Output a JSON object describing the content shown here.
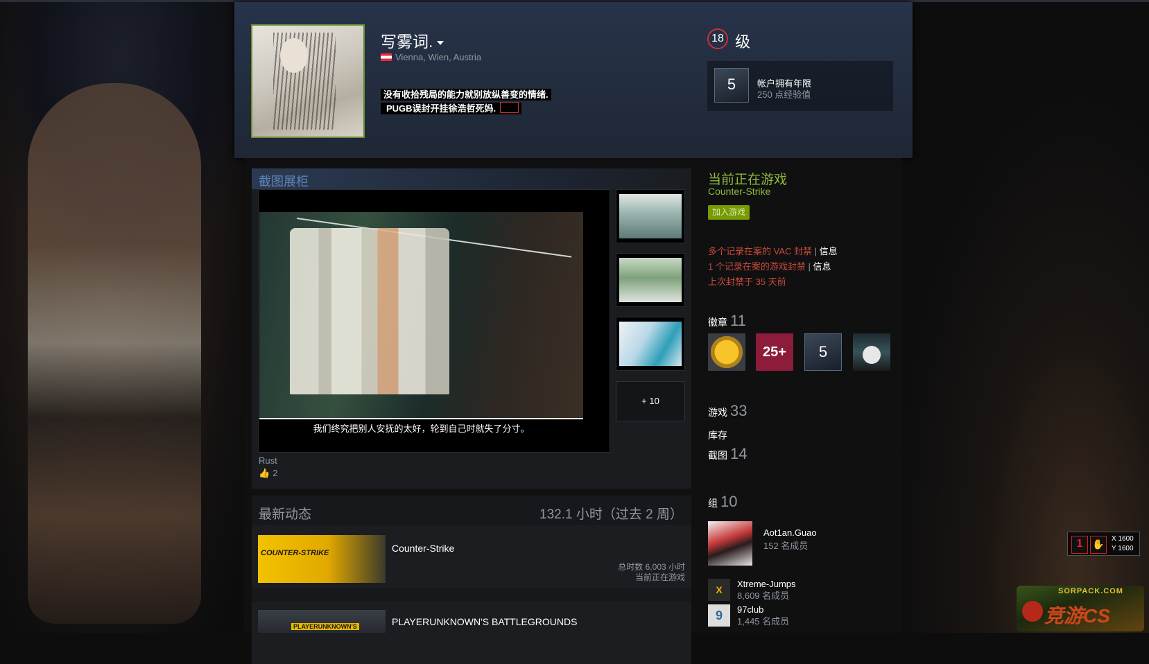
{
  "profile": {
    "persona_name": "写雾词.",
    "location": "Vienna, Wien, Austria",
    "summary_line1": "没有收拾残局的能力就别放纵善变的情绪.",
    "summary_line2": "PUGB误封开挂徐浩哲死妈."
  },
  "level": {
    "number": "18",
    "label": "级"
  },
  "favorite_badge": {
    "icon_number": "5",
    "title": "帐户拥有年限",
    "xp": "250 点经验值"
  },
  "showcase": {
    "title": "截图展柜",
    "caption": "我们终究把别人安抚的太好，轮到自己时就失了分寸。",
    "more_label": "+ 10",
    "game": "Rust",
    "likes": "2"
  },
  "recent": {
    "title": "最新动态",
    "hours": "132.1 小时（过去 2 周）",
    "games": [
      {
        "name": "Counter-Strike",
        "total": "总时数 6,003 小时",
        "status": "当前正在游戏",
        "capsule_text": "COUNTER-STRIKE"
      },
      {
        "name": "PLAYERUNKNOWN'S BATTLEGROUNDS",
        "capsule_text": "PLAYERUNKNOWN'S"
      }
    ]
  },
  "now_playing": {
    "title": "当前正在游戏",
    "game": "Counter-Strike",
    "join": "加入游戏"
  },
  "bans": {
    "vac": "多个记录在案的 VAC 封禁",
    "game": "1 个记录在案的游戏封禁",
    "separator": "|",
    "info": "信息",
    "last": "上次封禁于 35 天前"
  },
  "counts": {
    "badges_label": "徽章",
    "badges": "11",
    "badge2_text": "25+",
    "badge3_text": "5",
    "games_label": "游戏",
    "games": "33",
    "inventory_label": "库存",
    "screenshots_label": "截图",
    "screenshots": "14",
    "groups_label": "组",
    "groups": "10"
  },
  "groups": [
    {
      "name": "Aot1an.Guao",
      "members": "152 名成员"
    },
    {
      "name": "Xtreme-Jumps",
      "members": "8,609 名成员",
      "icon": "X"
    },
    {
      "name": "97club",
      "members": "1,445 名成员",
      "icon": "9"
    }
  ],
  "hud": {
    "x": "X 1600",
    "y": "Y 1600"
  },
  "watermark": {
    "site": "SORPACK.COM",
    "brand": "竞游CS"
  },
  "colors": {
    "accent_green": "#8fb93b",
    "ban_red": "#c94a3b",
    "level_ring": "#c4323f"
  }
}
